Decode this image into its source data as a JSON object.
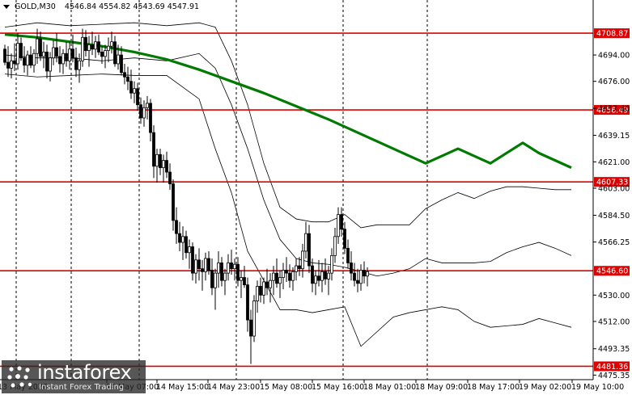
{
  "header": {
    "symbol": "GOLD,M30",
    "ohlc": "4546.84 4554.82 4543.69 4547.91"
  },
  "logo": {
    "name": "instaforex",
    "tagline": "Instant Forex Trading"
  },
  "colors": {
    "level_line": "#e00000",
    "ma_line": "#007a00",
    "candle": "#000000",
    "band": "#000000",
    "label_bg": "#e00000"
  },
  "chart_data": {
    "type": "candlestick",
    "title": "",
    "ylim": [
      4475.0,
      4715.0
    ],
    "y_ticks": [
      "4694.00",
      "4676.00",
      "4657.60",
      "4639.15",
      "4621.00",
      "4603.00",
      "4584.50",
      "4566.25",
      "4530.00",
      "4512.00",
      "4493.35",
      "4475.35"
    ],
    "x_tick_labels": [
      "13 May 2026",
      "14 May 07:00",
      "14 May 15:00",
      "14 May 23:00",
      "15 May 08:00",
      "15 May 16:00",
      "18 May 01:00",
      "18 May 09:00",
      "18 May 17:00",
      "19 May 02:00",
      "19 May 10:00"
    ],
    "period_separators": [
      4,
      21,
      42,
      72,
      105,
      131
    ],
    "levels": [
      {
        "label": "4708.87",
        "value": 4708.87
      },
      {
        "label": "4656.49",
        "value": 4656.49
      },
      {
        "label": "4607.33",
        "value": 4607.33
      },
      {
        "label": "4546.60",
        "value": 4546.6
      },
      {
        "label": "4481.36",
        "value": 4481.36
      }
    ],
    "moving_average": {
      "x": [
        0,
        10,
        20,
        30,
        40,
        50,
        60,
        70,
        80,
        90,
        100,
        110,
        120,
        130,
        140,
        150,
        160,
        165,
        175
      ],
      "y": [
        4708,
        4706,
        4703,
        4700,
        4696,
        4691,
        4684,
        4676,
        4668,
        4659,
        4650,
        4640,
        4630,
        4620,
        4630,
        4620,
        4634,
        4627,
        4617
      ]
    },
    "bollinger": {
      "x": [
        0,
        10,
        20,
        30,
        40,
        50,
        60,
        65,
        70,
        75,
        80,
        85,
        90,
        95,
        100,
        105,
        110,
        115,
        120,
        125,
        130,
        135,
        140,
        145,
        150,
        155,
        160,
        165,
        170,
        175
      ],
      "upper": [
        4713,
        4716,
        4714,
        4715,
        4716,
        4714,
        4716,
        4713,
        4690,
        4660,
        4620,
        4590,
        4582,
        4580,
        4580,
        4585,
        4576,
        4578,
        4578,
        4578,
        4589,
        4595,
        4600,
        4596,
        4601,
        4604,
        4604,
        4603,
        4602,
        4602
      ],
      "middle": [
        4694,
        4692,
        4692,
        4690,
        4692,
        4690,
        4695,
        4685,
        4660,
        4630,
        4595,
        4568,
        4555,
        4552,
        4551,
        4549,
        4546,
        4543,
        4545,
        4548,
        4555,
        4552,
        4552,
        4552,
        4553,
        4559,
        4563,
        4566,
        4562,
        4557
      ],
      "lower": [
        4681,
        4679,
        4680,
        4681,
        4680,
        4680,
        4664,
        4630,
        4600,
        4560,
        4540,
        4520,
        4520,
        4518,
        4520,
        4522,
        4495,
        4505,
        4515,
        4518,
        4520,
        4522,
        4520,
        4512,
        4508,
        4509,
        4510,
        4514,
        4511,
        4508
      ]
    },
    "candles_ohlc": [
      [
        4698,
        4701,
        4687,
        4689
      ],
      [
        4689,
        4700,
        4679,
        4685
      ],
      [
        4685,
        4695,
        4678,
        4690
      ],
      [
        4690,
        4702,
        4683,
        4688
      ],
      [
        4688,
        4709,
        4684,
        4702
      ],
      [
        4702,
        4706,
        4690,
        4692
      ],
      [
        4692,
        4700,
        4682,
        4687
      ],
      [
        4687,
        4697,
        4680,
        4694
      ],
      [
        4694,
        4700,
        4685,
        4687
      ],
      [
        4687,
        4698,
        4682,
        4695
      ],
      [
        4695,
        4712,
        4688,
        4705
      ],
      [
        4705,
        4710,
        4690,
        4693
      ],
      [
        4693,
        4703,
        4685,
        4696
      ],
      [
        4696,
        4701,
        4678,
        4683
      ],
      [
        4683,
        4696,
        4676,
        4692
      ],
      [
        4692,
        4704,
        4687,
        4699
      ],
      [
        4699,
        4709,
        4689,
        4693
      ],
      [
        4693,
        4700,
        4682,
        4688
      ],
      [
        4688,
        4698,
        4681,
        4695
      ],
      [
        4695,
        4703,
        4686,
        4690
      ],
      [
        4690,
        4703,
        4684,
        4698
      ],
      [
        4698,
        4708,
        4689,
        4692
      ],
      [
        4692,
        4699,
        4679,
        4684
      ],
      [
        4684,
        4695,
        4675,
        4690
      ],
      [
        4690,
        4712,
        4686,
        4706
      ],
      [
        4706,
        4711,
        4693,
        4697
      ],
      [
        4697,
        4707,
        4686,
        4701
      ],
      [
        4701,
        4710,
        4694,
        4698
      ],
      [
        4698,
        4707,
        4692,
        4703
      ],
      [
        4703,
        4708,
        4694,
        4696
      ],
      [
        4696,
        4700,
        4688,
        4693
      ],
      [
        4693,
        4701,
        4685,
        4697
      ],
      [
        4697,
        4706,
        4689,
        4700
      ],
      [
        4700,
        4710,
        4695,
        4703
      ],
      [
        4703,
        4707,
        4686,
        4688
      ],
      [
        4688,
        4701,
        4684,
        4694
      ],
      [
        4694,
        4700,
        4680,
        4682
      ],
      [
        4682,
        4688,
        4674,
        4679
      ],
      [
        4679,
        4686,
        4670,
        4676
      ],
      [
        4676,
        4684,
        4664,
        4668
      ],
      [
        4668,
        4676,
        4661,
        4671
      ],
      [
        4671,
        4675,
        4656,
        4660
      ],
      [
        4660,
        4665,
        4647,
        4651
      ],
      [
        4651,
        4663,
        4645,
        4658
      ],
      [
        4658,
        4666,
        4650,
        4661
      ],
      [
        4661,
        4664,
        4635,
        4641
      ],
      [
        4641,
        4646,
        4610,
        4618
      ],
      [
        4618,
        4630,
        4607,
        4626
      ],
      [
        4626,
        4630,
        4612,
        4617
      ],
      [
        4617,
        4626,
        4607,
        4622
      ],
      [
        4622,
        4628,
        4610,
        4614
      ],
      [
        4614,
        4620,
        4602,
        4606
      ],
      [
        4606,
        4609,
        4574,
        4581
      ],
      [
        4581,
        4590,
        4565,
        4572
      ],
      [
        4572,
        4580,
        4560,
        4566
      ],
      [
        4566,
        4577,
        4554,
        4570
      ],
      [
        4570,
        4574,
        4555,
        4559
      ],
      [
        4559,
        4568,
        4548,
        4563
      ],
      [
        4563,
        4566,
        4540,
        4545
      ],
      [
        4545,
        4558,
        4538,
        4554
      ],
      [
        4554,
        4562,
        4540,
        4548
      ],
      [
        4548,
        4554,
        4533,
        4546
      ],
      [
        4546,
        4559,
        4540,
        4555
      ],
      [
        4555,
        4560,
        4544,
        4547
      ],
      [
        4547,
        4555,
        4530,
        4535
      ],
      [
        4535,
        4548,
        4520,
        4545
      ],
      [
        4545,
        4560,
        4535,
        4552
      ],
      [
        4552,
        4556,
        4536,
        4540
      ],
      [
        4540,
        4548,
        4530,
        4545
      ],
      [
        4545,
        4558,
        4540,
        4552
      ],
      [
        4552,
        4561,
        4544,
        4548
      ],
      [
        4548,
        4555,
        4540,
        4551
      ],
      [
        4551,
        4556,
        4536,
        4540
      ],
      [
        4540,
        4547,
        4528,
        4542
      ],
      [
        4542,
        4550,
        4535,
        4537
      ],
      [
        4537,
        4542,
        4505,
        4513
      ],
      [
        4513,
        4520,
        4483,
        4502
      ],
      [
        4502,
        4530,
        4498,
        4526
      ],
      [
        4526,
        4540,
        4518,
        4536
      ],
      [
        4536,
        4542,
        4525,
        4530
      ],
      [
        4530,
        4542,
        4524,
        4539
      ],
      [
        4539,
        4548,
        4530,
        4535
      ],
      [
        4535,
        4545,
        4525,
        4540
      ],
      [
        4540,
        4550,
        4530,
        4545
      ],
      [
        4545,
        4555,
        4535,
        4538
      ],
      [
        4538,
        4547,
        4528,
        4542
      ],
      [
        4542,
        4552,
        4534,
        4547
      ],
      [
        4547,
        4556,
        4539,
        4545
      ],
      [
        4545,
        4551,
        4535,
        4540
      ],
      [
        4540,
        4549,
        4533,
        4546
      ],
      [
        4546,
        4555,
        4540,
        4550
      ],
      [
        4550,
        4556,
        4543,
        4548
      ],
      [
        4548,
        4565,
        4542,
        4560
      ],
      [
        4560,
        4580,
        4555,
        4572
      ],
      [
        4572,
        4578,
        4545,
        4550
      ],
      [
        4550,
        4555,
        4532,
        4538
      ],
      [
        4538,
        4547,
        4530,
        4543
      ],
      [
        4543,
        4554,
        4536,
        4540
      ],
      [
        4540,
        4552,
        4532,
        4546
      ],
      [
        4546,
        4555,
        4537,
        4541
      ],
      [
        4541,
        4550,
        4530,
        4545
      ],
      [
        4545,
        4562,
        4540,
        4557
      ],
      [
        4557,
        4576,
        4552,
        4570
      ],
      [
        4570,
        4590,
        4565,
        4585
      ],
      [
        4585,
        4590,
        4570,
        4575
      ],
      [
        4575,
        4580,
        4558,
        4562
      ],
      [
        4562,
        4568,
        4548,
        4552
      ],
      [
        4552,
        4560,
        4540,
        4545
      ],
      [
        4545,
        4552,
        4536,
        4540
      ],
      [
        4540,
        4548,
        4532,
        4538
      ],
      [
        4538,
        4551,
        4533,
        4547
      ],
      [
        4547,
        4553,
        4538,
        4543
      ],
      [
        4543,
        4549,
        4536,
        4546
      ]
    ]
  }
}
